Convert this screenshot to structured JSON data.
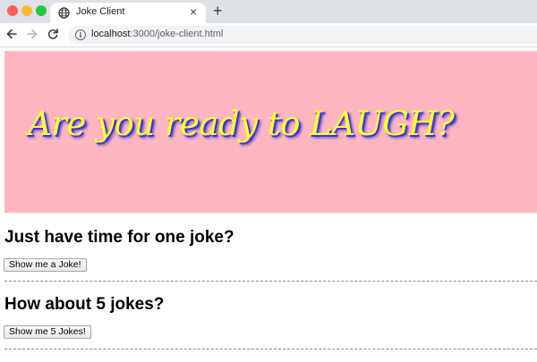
{
  "browser": {
    "tab_title": "Joke Client",
    "close_glyph": "×",
    "new_tab_glyph": "+",
    "url_host": "localhost",
    "url_path": ":3000/joke-client.html",
    "icons": {
      "tab": "globe-icon",
      "back": "arrow-left-icon",
      "forward": "arrow-right-icon",
      "reload": "reload-icon",
      "site_info": "info-icon"
    }
  },
  "page": {
    "banner_text": "Are you ready to LAUGH?",
    "banner_bg": "#ffb6c1",
    "banner_text_color": "#ffff2e",
    "banner_shadow_color": "#3b3bd2",
    "sections": [
      {
        "heading": "Just have time for one joke?",
        "button_label": "Show me a Joke!"
      },
      {
        "heading": "How about 5 jokes?",
        "button_label": "Show me 5 Jokes!"
      }
    ]
  }
}
